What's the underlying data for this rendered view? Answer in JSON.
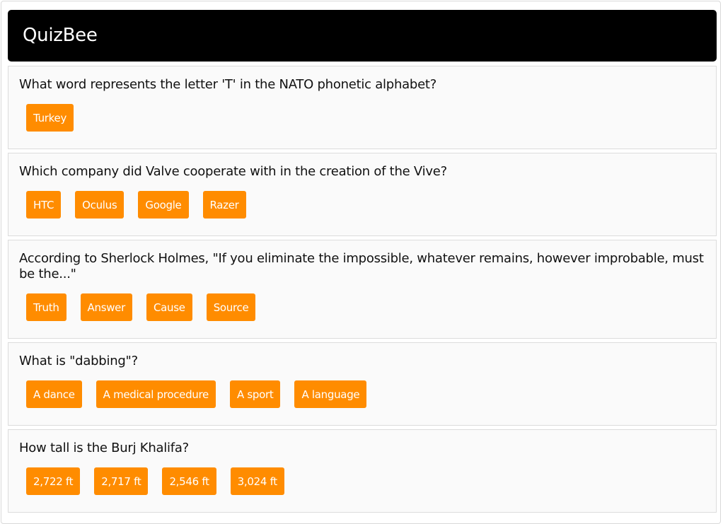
{
  "app": {
    "title": "QuizBee"
  },
  "colors": {
    "header_bg": "#000000",
    "card_bg": "#fafafa",
    "answer_bg": "#ff8c00",
    "answer_text": "#ffffff"
  },
  "questions": [
    {
      "text": "What word represents the letter 'T' in the NATO phonetic alphabet?",
      "answers": [
        "Turkey"
      ]
    },
    {
      "text": "Which company did Valve cooperate with in the creation of the Vive?",
      "answers": [
        "HTC",
        "Oculus",
        "Google",
        "Razer"
      ]
    },
    {
      "text": "According to Sherlock Holmes, \"If you eliminate the impossible, whatever remains, however improbable, must be the...\"",
      "answers": [
        "Truth",
        "Answer",
        "Cause",
        "Source"
      ]
    },
    {
      "text": "What is \"dabbing\"?",
      "answers": [
        "A dance",
        "A medical procedure",
        "A sport",
        "A language"
      ]
    },
    {
      "text": "How tall is the Burj Khalifa?",
      "answers": [
        "2,722 ft",
        "2,717 ft",
        "2,546 ft",
        "3,024 ft"
      ]
    }
  ]
}
